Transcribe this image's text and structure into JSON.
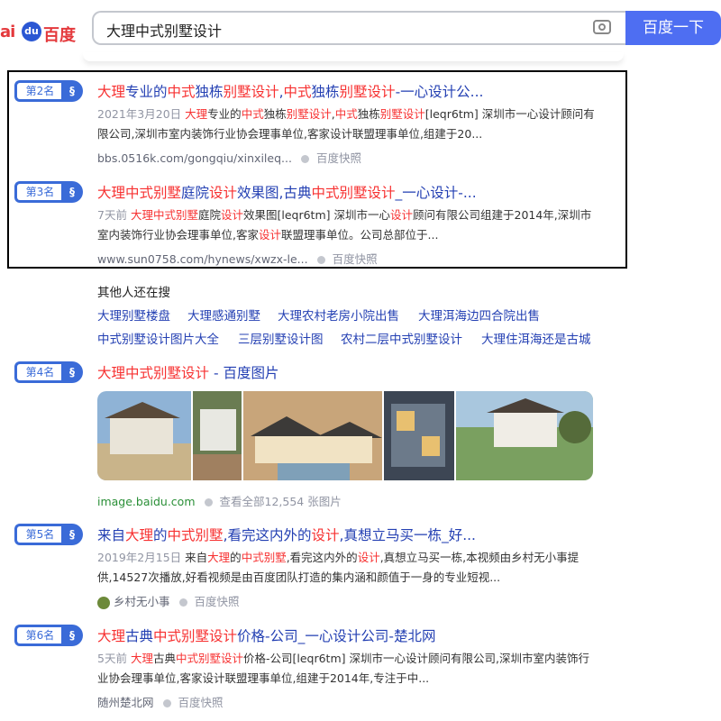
{
  "header": {
    "logo_left": "ai",
    "logo_paw": "du",
    "logo_right": "百度",
    "search_value": "大理中式别墅设计",
    "search_button": "百度一下",
    "camera_icon": "camera-icon"
  },
  "results": [
    {
      "rank": "第2名",
      "title_parts": [
        "大理",
        "专业的",
        "中式",
        "独栋",
        "别墅设计",
        ",",
        "中式",
        "独栋",
        "别墅设计",
        "-一心设计公..."
      ],
      "date": "2021年3月20日",
      "abstract_line1": "大理专业的中式独栋别墅设计,中式独栋别墅设计[leqr6tm] 深圳市一心设计顾问有",
      "abstract_line2": "限公司,深圳市室内装饰行业协会理事单位,客家设计联盟理事单位,组建于20...",
      "url": "bbs.0516k.com/gongqiu/xinxileq...",
      "snapshot": "百度快照"
    },
    {
      "rank": "第3名",
      "date": "7天前",
      "abstract_line1": "大理中式别墅庭院设计效果图[leqr6tm] 深圳市一心设计顾问有限公司组建于2014年,深圳市",
      "abstract_line2": "室内装饰行业协会理事单位,客家设计联盟理事单位。公司总部位于...",
      "url": "www.sun0758.com/hynews/xwzx-le...",
      "snapshot": "百度快照"
    },
    {
      "rank": "第4名",
      "title_hl": "大理中式别墅设计",
      "title_rest": " - 百度图片",
      "site": "image.baidu.com",
      "more": "查看全部12,554 张图片"
    },
    {
      "rank": "第5名",
      "date": "2019年2月15日",
      "abstract_line1": "来自大理的中式别墅,看完这内外的设计,真想立马买一栋,本视频由乡村无小事提",
      "abstract_line2": "供,14527次播放,好看视频是由百度团队打造的集内涵和颜值于一身的专业短视...",
      "author": "乡村无小事",
      "snapshot": "百度快照"
    },
    {
      "rank": "第6名",
      "date": "5天前",
      "abstract_line1": "大理古典中式别墅设计价格-公司[leqr6tm] 深圳市一心设计顾问有限公司,深圳市室内装饰行",
      "abstract_line2": "业协会理事单位,客家设计联盟理事单位,组建于2014年,专注于中...",
      "source": "随州楚北网",
      "snapshot": "百度快照"
    }
  ],
  "others_search": {
    "label": "其他人还在搜",
    "row1": [
      "大理别墅楼盘",
      "大理感通别墅",
      "大理农村老房小院出售",
      "大理洱海边四合院出售"
    ],
    "row2": [
      "中式别墅设计图片大全",
      "三层别墅设计图",
      "农村二层中式别墅设计",
      "大理住洱海还是古城"
    ]
  }
}
